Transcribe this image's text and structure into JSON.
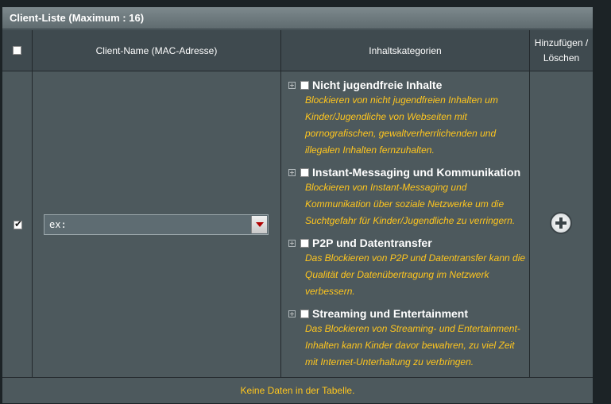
{
  "table": {
    "title": "Client-Liste (Maximum : 16)",
    "headers": {
      "client_name": "Client-Name (MAC-Adresse)",
      "categories": "Inhaltskategorien",
      "add_delete": "Hinzufügen / Löschen"
    },
    "row": {
      "checked": true,
      "client_select_value": "ex:",
      "categories": [
        {
          "title": "Nicht jugendfreie Inhalte",
          "checked": false,
          "desc": [
            "Blockieren von nicht jugendfreien Inhalten um",
            "Kinder/Jugendliche von Webseiten mit",
            "pornografischen, gewaltverherrlichenden und",
            "illegalen Inhalten fernzuhalten."
          ]
        },
        {
          "title": "Instant-Messaging und Kommunikation",
          "checked": false,
          "desc": [
            "Blockieren von Instant-Messaging und",
            "Kommunikation über soziale Netzwerke um die",
            "Suchtgefahr für Kinder/Jugendliche zu verringern."
          ]
        },
        {
          "title": "P2P und Datentransfer",
          "checked": false,
          "desc": [
            "Das Blockieren von P2P und Datentransfer kann die",
            "Qualität der Datenübertragung im Netzwerk",
            "verbessern."
          ]
        },
        {
          "title": "Streaming und Entertainment",
          "checked": false,
          "desc": [
            "Das Blockieren von Streaming- und Entertainment-",
            "Inhalten kann Kinder davor bewahren, zu viel Zeit",
            "mit Internet-Unterhaltung zu verbringen."
          ]
        }
      ]
    },
    "footer": "Keine Daten in der Tabelle."
  }
}
